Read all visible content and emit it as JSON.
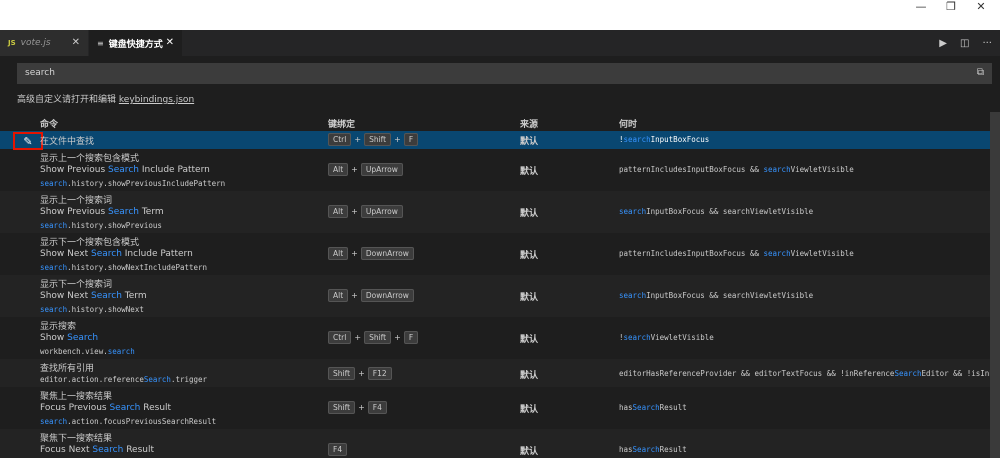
{
  "window": {
    "minimize": "—",
    "restore": "❐",
    "close": "✕"
  },
  "tabs": [
    {
      "badge": "JS",
      "label": "vote.js",
      "close": "✕"
    },
    {
      "label": "键盘快捷方式",
      "close": "✕",
      "icon": "keyboard-icon"
    }
  ],
  "editor_actions": {
    "run": "▶",
    "split": "◫",
    "more": "···"
  },
  "search": {
    "value": "search",
    "placeholder": ""
  },
  "hint": {
    "text": "高级自定义请打开和编辑",
    "link": "keybindings.json"
  },
  "columns": {
    "command": "命令",
    "keybinding": "键绑定",
    "source": "来源",
    "when": "何时"
  },
  "rows": [
    {
      "title": "在文件中查找",
      "keys": [
        "Ctrl",
        "Shift",
        "F"
      ],
      "source": "默认",
      "when_pre": "!",
      "when_hl": "search",
      "when_post": "InputBoxFocus"
    },
    {
      "title": "显示上一个搜索包含模式",
      "label_pre": "Show Previous ",
      "label_hl": "Search",
      "label_post": " Include Pattern",
      "id_hl": "search",
      "id_post": ".history.showPreviousIncludePattern",
      "keys": [
        "Alt",
        "UpArrow"
      ],
      "source": "默认",
      "when_pre": "patternIncludesInputBoxFocus && ",
      "when_hl": "search",
      "when_post": "ViewletVisible"
    },
    {
      "title": "显示上一个搜索词",
      "label_pre": "Show Previous ",
      "label_hl": "Search",
      "label_post": " Term",
      "id_hl": "search",
      "id_post": ".history.showPrevious",
      "keys": [
        "Alt",
        "UpArrow"
      ],
      "source": "默认",
      "when_pre": "",
      "when_hl": "search",
      "when_post": "InputBoxFocus && searchViewletVisible"
    },
    {
      "title": "显示下一个搜索包含模式",
      "label_pre": "Show Next ",
      "label_hl": "Search",
      "label_post": " Include Pattern",
      "id_hl": "search",
      "id_post": ".history.showNextIncludePattern",
      "keys": [
        "Alt",
        "DownArrow"
      ],
      "source": "默认",
      "when_pre": "patternIncludesInputBoxFocus && ",
      "when_hl": "search",
      "when_post": "ViewletVisible"
    },
    {
      "title": "显示下一个搜索词",
      "label_pre": "Show Next ",
      "label_hl": "Search",
      "label_post": " Term",
      "id_hl": "search",
      "id_post": ".history.showNext",
      "keys": [
        "Alt",
        "DownArrow"
      ],
      "source": "默认",
      "when_pre": "",
      "when_hl": "search",
      "when_post": "InputBoxFocus && searchViewletVisible"
    },
    {
      "title": "显示搜索",
      "label_pre": "Show ",
      "label_hl": "Search",
      "label_post": "",
      "id_pre": "workbench.view.",
      "id_hl": "search",
      "id_post": "",
      "keys": [
        "Ctrl",
        "Shift",
        "F"
      ],
      "source": "默认",
      "when_pre": "!",
      "when_hl": "search",
      "when_post": "ViewletVisible"
    },
    {
      "title": "查找所有引用",
      "id_pre": "editor.action.reference",
      "id_hl": "Search",
      "id_post": ".trigger",
      "keys": [
        "Shift",
        "F12"
      ],
      "source": "默认",
      "when_pre": "editorHasReferenceProvider && editorTextFocus && !inReference",
      "when_hl": "Search",
      "when_post": "Editor && !isInE..."
    },
    {
      "title": "聚焦上一搜索结果",
      "label_pre": "Focus Previous ",
      "label_hl": "Search",
      "label_post": " Result",
      "id_hl": "search",
      "id_post": ".action.focusPreviousSearchResult",
      "keys": [
        "Shift",
        "F4"
      ],
      "source": "默认",
      "when_pre": "has",
      "when_hl": "Search",
      "when_post": "Result"
    },
    {
      "title": "聚焦下一搜索结果",
      "label_pre": "Focus Next ",
      "label_hl": "Search",
      "label_post": " Result",
      "keys": [
        "F4"
      ],
      "source": "默认",
      "when_pre": "has",
      "when_hl": "Search",
      "when_post": "Result"
    }
  ]
}
